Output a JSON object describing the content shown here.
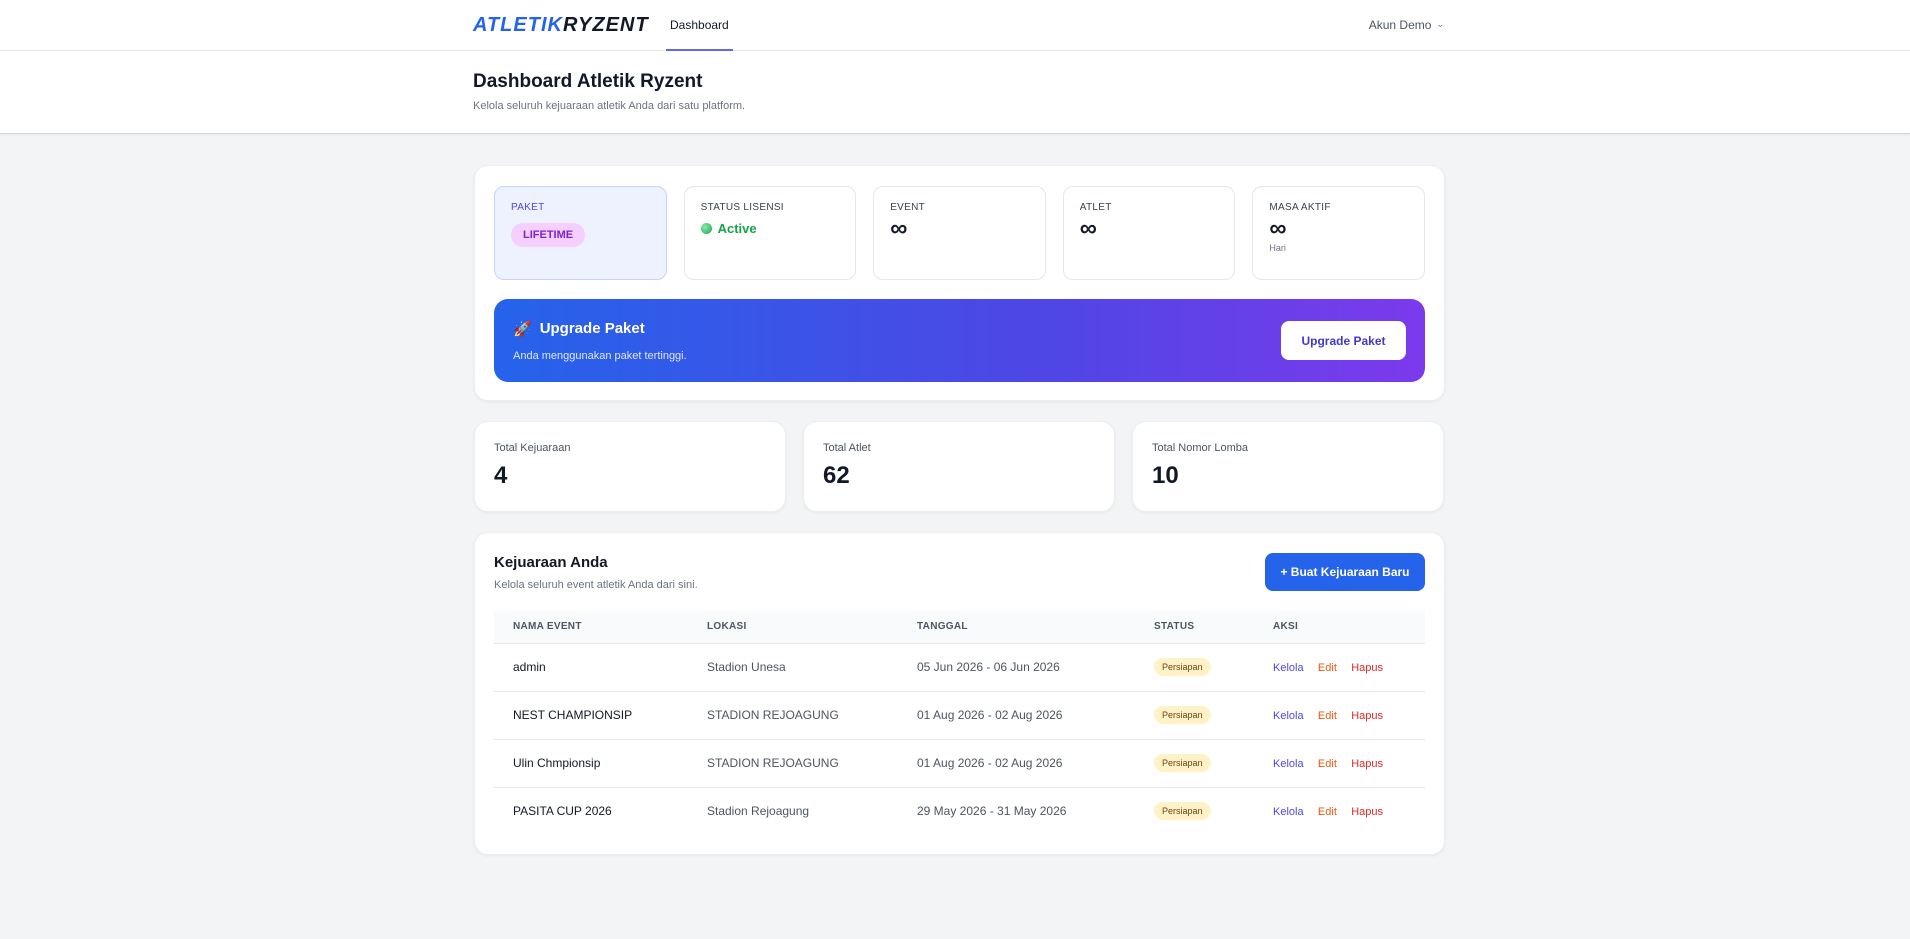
{
  "nav": {
    "logo_a": "ATLETIK",
    "logo_b": "RYZENT",
    "dashboard_link": "Dashboard",
    "account_label": "Akun Demo"
  },
  "header": {
    "title": "Dashboard Atletik Ryzent",
    "subtitle": "Kelola seluruh kejuaraan atletik Anda dari satu platform."
  },
  "license": {
    "paket_label": "PAKET",
    "paket_value": "LIFETIME",
    "status_label": "STATUS LISENSI",
    "status_value": "Active",
    "event_label": "EVENT",
    "event_value": "∞",
    "atlet_label": "ATLET",
    "atlet_value": "∞",
    "masa_label": "MASA AKTIF",
    "masa_value": "∞",
    "masa_unit": "Hari"
  },
  "upgrade": {
    "icon": "🚀",
    "title": "Upgrade Paket",
    "subtitle": "Anda menggunakan paket tertinggi.",
    "button": "Upgrade Paket"
  },
  "stats": {
    "kejuaraan_label": "Total Kejuaraan",
    "kejuaraan_value": "4",
    "atlet_label": "Total Atlet",
    "atlet_value": "62",
    "nomor_label": "Total Nomor Lomba",
    "nomor_value": "10"
  },
  "events": {
    "title": "Kejuaraan Anda",
    "subtitle": "Kelola seluruh event atletik Anda dari sini.",
    "new_button": "+ Buat Kejuaraan Baru",
    "columns": [
      "NAMA EVENT",
      "LOKASI",
      "TANGGAL",
      "STATUS",
      "AKSI"
    ],
    "rows": [
      {
        "name": "admin",
        "location": "Stadion Unesa",
        "date": "05 Jun 2026 - 06 Jun 2026",
        "status": "Persiapan"
      },
      {
        "name": "NEST CHAMPIONSIP",
        "location": "STADION REJOAGUNG",
        "date": "01 Aug 2026 - 02 Aug 2026",
        "status": "Persiapan"
      },
      {
        "name": "Ulin Chmpionsip",
        "location": "STADION REJOAGUNG",
        "date": "01 Aug 2026 - 02 Aug 2026",
        "status": "Persiapan"
      },
      {
        "name": "PASITA CUP 2026",
        "location": "Stadion Rejoagung",
        "date": "29 May 2026 - 31 May 2026",
        "status": "Persiapan"
      }
    ],
    "actions": {
      "kelola": "Kelola",
      "edit": "Edit",
      "hapus": "Hapus"
    }
  }
}
